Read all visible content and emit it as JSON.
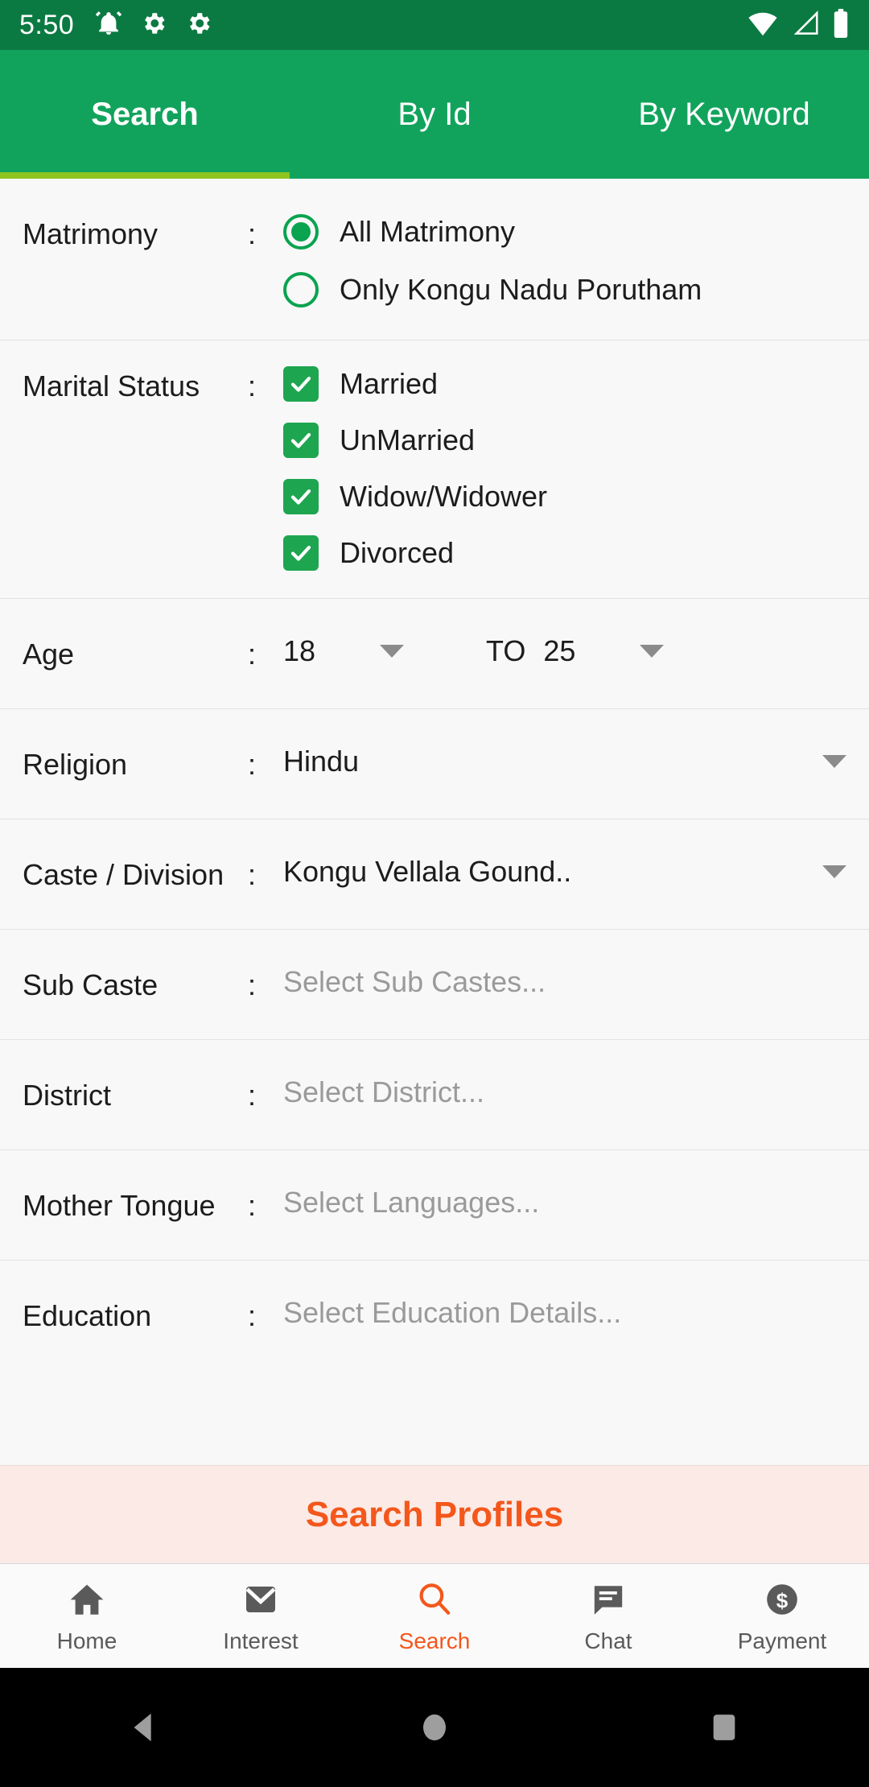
{
  "status_bar": {
    "time": "5:50",
    "left_icons": [
      "alarm-icon",
      "gear-icon",
      "gear-icon"
    ],
    "right_icons": [
      "wifi-icon",
      "signal-icon",
      "battery-icon"
    ],
    "background_color": "#0b7a42"
  },
  "tabs": {
    "accent_color": "#8fc31f",
    "bar_color": "#11a35c",
    "items": [
      {
        "label": "Search",
        "active": true
      },
      {
        "label": "By Id",
        "active": false
      },
      {
        "label": "By Keyword",
        "active": false
      }
    ]
  },
  "form": {
    "matrimony": {
      "label": "Matrimony",
      "colon": ":",
      "options": [
        {
          "label": "All Matrimony",
          "selected": true
        },
        {
          "label": "Only Kongu Nadu Porutham",
          "selected": false
        }
      ]
    },
    "marital_status": {
      "label": "Marital Status",
      "colon": ":",
      "options": [
        {
          "label": "Married",
          "checked": true
        },
        {
          "label": "UnMarried",
          "checked": true
        },
        {
          "label": "Widow/Widower",
          "checked": true
        },
        {
          "label": "Divorced",
          "checked": true
        }
      ]
    },
    "age": {
      "label": "Age",
      "colon": ":",
      "from": "18",
      "separator": "TO",
      "to": "25"
    },
    "religion": {
      "label": "Religion",
      "colon": ":",
      "value": "Hindu"
    },
    "caste": {
      "label": "Caste / Division",
      "colon": ":",
      "value": "Kongu Vellala Gound.."
    },
    "sub_caste": {
      "label": "Sub Caste",
      "colon": ":",
      "placeholder": "Select Sub Castes..."
    },
    "district": {
      "label": "District",
      "colon": ":",
      "placeholder": "Select District..."
    },
    "mother_tongue": {
      "label": "Mother Tongue",
      "colon": ":",
      "placeholder": "Select Languages..."
    },
    "education": {
      "label": "Education",
      "colon": ":",
      "placeholder": "Select Education Details..."
    }
  },
  "search_button": {
    "label": "Search Profiles",
    "text_color": "#f4571b",
    "background_color": "#fbeae6"
  },
  "bottom_nav": {
    "active_color": "#f4571b",
    "inactive_color": "#5a5a5a",
    "items": [
      {
        "label": "Home",
        "icon": "home-icon",
        "active": false
      },
      {
        "label": "Interest",
        "icon": "envelope-icon",
        "active": false
      },
      {
        "label": "Search",
        "icon": "magnifier-icon",
        "active": true
      },
      {
        "label": "Chat",
        "icon": "chat-bubble-icon",
        "active": false
      },
      {
        "label": "Payment",
        "icon": "dollar-coin-icon",
        "active": false
      }
    ]
  },
  "android_nav": {
    "buttons": [
      "back-triangle-icon",
      "home-circle-icon",
      "recents-square-icon"
    ]
  }
}
